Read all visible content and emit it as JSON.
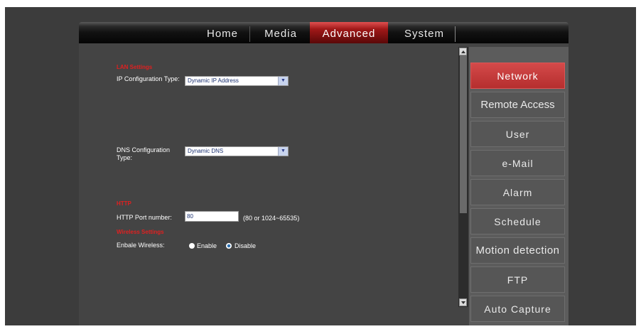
{
  "nav": {
    "tabs": [
      {
        "label": "Home"
      },
      {
        "label": "Media"
      },
      {
        "label": "Advanced"
      },
      {
        "label": "System"
      }
    ],
    "active": "Advanced"
  },
  "sidebar": {
    "items": [
      {
        "label": "Network"
      },
      {
        "label": "Remote Access"
      },
      {
        "label": "User"
      },
      {
        "label": "e-Mail"
      },
      {
        "label": "Alarm"
      },
      {
        "label": "Schedule"
      },
      {
        "label": "Motion detection"
      },
      {
        "label": "FTP"
      },
      {
        "label": "Auto Capture"
      }
    ],
    "active": "Network"
  },
  "lan": {
    "title": "LAN Settings",
    "ip_label": "IP Configuration Type:",
    "ip_value": "Dynamic IP Address",
    "dns_label": "DNS Configuration Type:",
    "dns_value": "Dynamic DNS"
  },
  "http": {
    "title": "HTTP",
    "port_label": "HTTP Port number:",
    "port_value": "80",
    "port_hint": "(80 or 1024~65535)"
  },
  "wireless": {
    "title": "Wireless Settings",
    "label": "Enbale Wireless:",
    "enable": "Enable",
    "disable": "Disable",
    "selected": "Disable"
  },
  "colors": {
    "accent": "#c23232",
    "section_title": "#e02020"
  }
}
